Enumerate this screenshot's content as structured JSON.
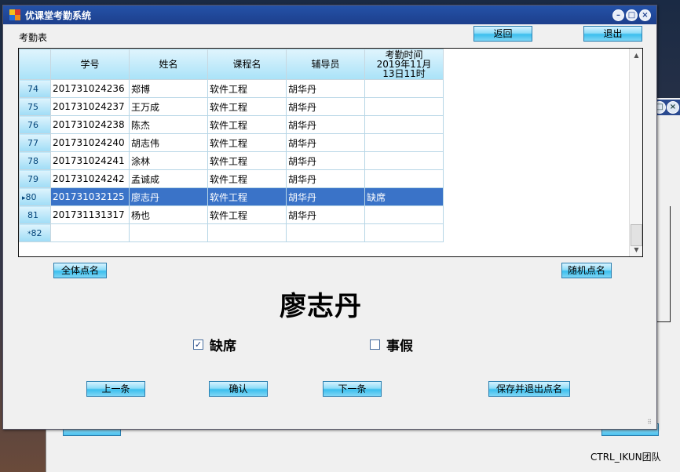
{
  "window": {
    "title": "优课堂考勤系统",
    "table_label": "考勤表"
  },
  "toolbar": {
    "back_label": "返回",
    "exit_label": "退出"
  },
  "grid": {
    "columns": [
      "学号",
      "姓名",
      "课程名",
      "辅导员",
      "考勤时间\n2019年11月\n13日11时"
    ],
    "rows": [
      {
        "num": "74",
        "id": "201731024236",
        "name": "郑博",
        "course": "软件工程",
        "counselor": "胡华丹",
        "status": ""
      },
      {
        "num": "75",
        "id": "201731024237",
        "name": "王万成",
        "course": "软件工程",
        "counselor": "胡华丹",
        "status": ""
      },
      {
        "num": "76",
        "id": "201731024238",
        "name": "陈杰",
        "course": "软件工程",
        "counselor": "胡华丹",
        "status": ""
      },
      {
        "num": "77",
        "id": "201731024240",
        "name": "胡志伟",
        "course": "软件工程",
        "counselor": "胡华丹",
        "status": ""
      },
      {
        "num": "78",
        "id": "201731024241",
        "name": "涂林",
        "course": "软件工程",
        "counselor": "胡华丹",
        "status": ""
      },
      {
        "num": "79",
        "id": "201731024242",
        "name": "孟诚成",
        "course": "软件工程",
        "counselor": "胡华丹",
        "status": ""
      },
      {
        "num": "80",
        "id": "201731032125",
        "name": "廖志丹",
        "course": "软件工程",
        "counselor": "胡华丹",
        "status": "缺席",
        "selected": true
      },
      {
        "num": "81",
        "id": "201731131317",
        "name": "杨也",
        "course": "软件工程",
        "counselor": "胡华丹",
        "status": ""
      },
      {
        "num": "82",
        "id": "",
        "name": "",
        "course": "",
        "counselor": "",
        "status": "",
        "new_row": true
      }
    ]
  },
  "actions": {
    "all_label": "全体点名",
    "random_label": "随机点名"
  },
  "current": {
    "name": "廖志丹"
  },
  "options": {
    "absent_label": "缺席",
    "absent_checked": true,
    "leave_label": "事假",
    "leave_checked": false
  },
  "nav": {
    "prev_label": "上一条",
    "confirm_label": "确认",
    "next_label": "下一条",
    "save_exit_label": "保存并退出点名"
  },
  "footer": {
    "team": "CTRL_IKUN团队"
  }
}
